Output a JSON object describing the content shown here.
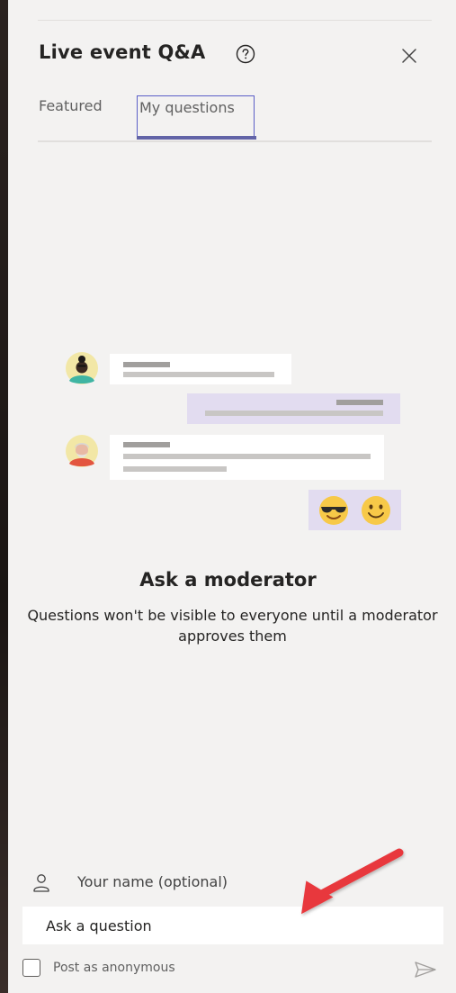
{
  "header": {
    "title": "Live event Q&A",
    "help_icon": "help-circle-icon",
    "close_icon": "close-icon"
  },
  "tabs": [
    {
      "label": "Featured",
      "selected": false
    },
    {
      "label": "My questions",
      "selected": true
    }
  ],
  "empty_state": {
    "heading": "Ask a moderator",
    "description": "Questions won't be visible to everyone until a moderator approves them"
  },
  "compose": {
    "name_placeholder": "Your name (optional)",
    "question_placeholder": "Ask a question",
    "anonymous_label": "Post as anonymous",
    "anonymous_checked": false,
    "send_icon": "send-icon"
  },
  "colors": {
    "accent": "#6264a7",
    "annotation_arrow": "#e8383d",
    "background": "#f3f2f1"
  }
}
